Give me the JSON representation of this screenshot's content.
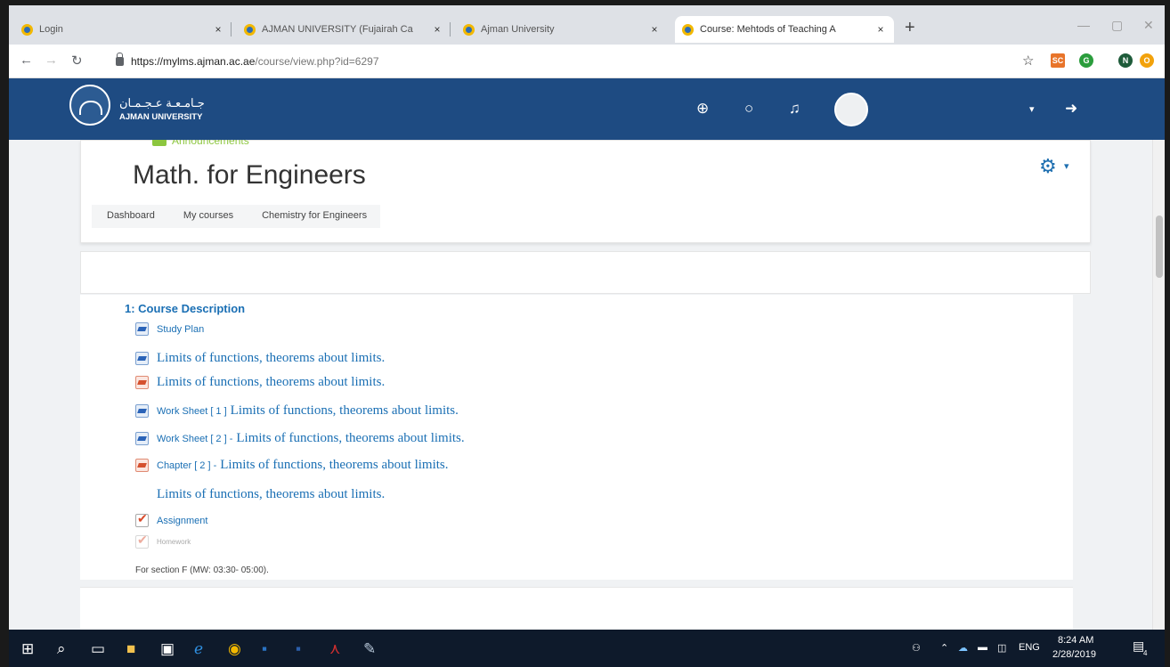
{
  "browser": {
    "tabs": [
      {
        "title": "Login",
        "close": "×"
      },
      {
        "title": "AJMAN UNIVERSITY (Fujairah Ca",
        "close": "×"
      },
      {
        "title": "Ajman University",
        "close": "×"
      },
      {
        "title": "Course: Mehtods of Teaching A",
        "close": "×"
      }
    ],
    "new_tab": "+",
    "url": {
      "host": "https://mylms.ajman.ac.ae",
      "path": "/course/view.php?id=6297"
    },
    "extensions": [
      {
        "label": "SC",
        "color": "#e8742a"
      },
      {
        "label": "G",
        "color": "#2a9d3c"
      },
      {
        "label": "N",
        "color": "#1e5b3a"
      },
      {
        "label": "O",
        "color": "#f2a20c"
      }
    ]
  },
  "site": {
    "brand_arabic": "جـامـعـة عـجـمـان",
    "brand_english": "AJMAN UNIVERSITY",
    "navbar_color": "#1e4b82"
  },
  "course": {
    "ghost_item": "Announcements",
    "title": "Math. for Engineers",
    "breadcrumbs": [
      "Dashboard",
      "My courses",
      "Chemistry for Engineers"
    ]
  },
  "section": {
    "title": "1: Course Description",
    "activities": [
      {
        "icon": "word-icon",
        "prefix": "Study Plan",
        "text": ""
      },
      {
        "icon": "word-icon",
        "prefix": "",
        "text": "Limits of functions, theorems about limits."
      },
      {
        "icon": "pdf-icon",
        "prefix": "",
        "text": "Limits of functions, theorems about limits."
      },
      {
        "icon": "word-icon",
        "prefix": "Work Sheet [ 1 ]",
        "text": "Limits of functions, theorems about limits."
      },
      {
        "icon": "word-icon",
        "prefix": "Work Sheet [ 2 ] -",
        "text": "Limits of functions, theorems about limits."
      },
      {
        "icon": "pdf-icon",
        "prefix": "Chapter [ 2 ] -",
        "text": "Limits of functions, theorems about limits."
      },
      {
        "icon": "page-icon",
        "prefix": "",
        "text": "Limits of functions, theorems about limits."
      },
      {
        "icon": "assign-icon",
        "prefix": "Assignment",
        "text": ""
      },
      {
        "icon": "assign-icon",
        "prefix": "Homework",
        "text": ""
      }
    ],
    "note": "For section F (MW: 03:30- 05:00)."
  },
  "taskbar": {
    "language": "ENG",
    "time": "8:24 AM",
    "date": "2/28/2019",
    "notification_count": "4"
  }
}
